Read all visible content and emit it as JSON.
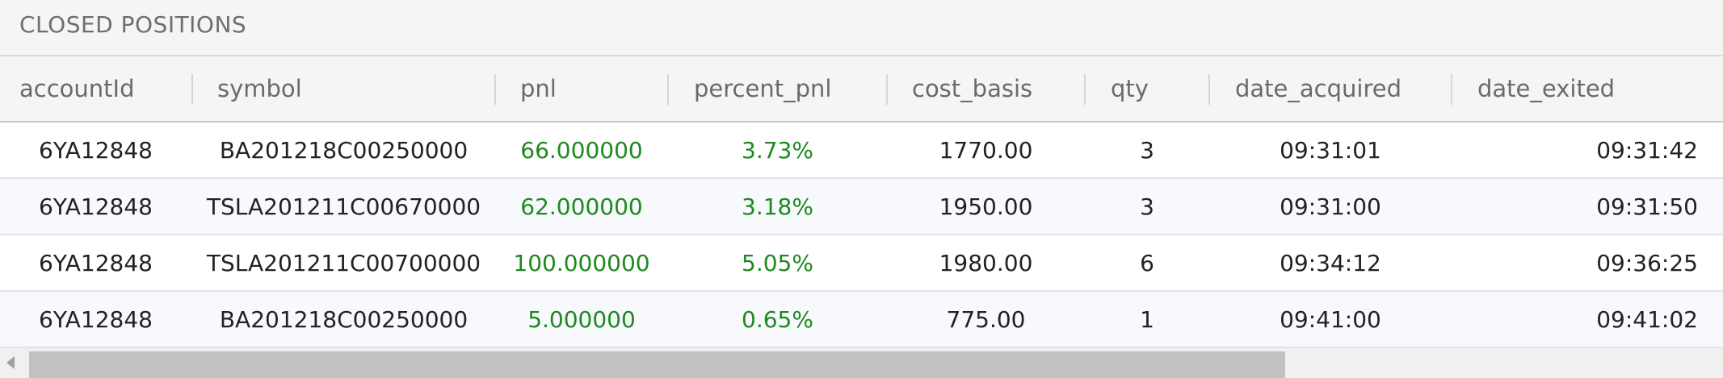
{
  "panel": {
    "title": "CLOSED POSITIONS"
  },
  "columns": {
    "accountId": "accountId",
    "symbol": "symbol",
    "pnl": "pnl",
    "percent_pnl": "percent_pnl",
    "cost_basis": "cost_basis",
    "qty": "qty",
    "date_acquired": "date_acquired",
    "date_exited": "date_exited"
  },
  "rows": [
    {
      "accountId": "6YA12848",
      "symbol": "BA201218C00250000",
      "pnl": "66.000000",
      "percent_pnl": "3.73%",
      "cost_basis": "1770.00",
      "qty": "3",
      "date_acquired": "09:31:01",
      "date_exited": "09:31:42"
    },
    {
      "accountId": "6YA12848",
      "symbol": "TSLA201211C00670000",
      "pnl": "62.000000",
      "percent_pnl": "3.18%",
      "cost_basis": "1950.00",
      "qty": "3",
      "date_acquired": "09:31:00",
      "date_exited": "09:31:50"
    },
    {
      "accountId": "6YA12848",
      "symbol": "TSLA201211C00700000",
      "pnl": "100.000000",
      "percent_pnl": "5.05%",
      "cost_basis": "1980.00",
      "qty": "6",
      "date_acquired": "09:34:12",
      "date_exited": "09:36:25"
    },
    {
      "accountId": "6YA12848",
      "symbol": "BA201218C00250000",
      "pnl": "5.000000",
      "percent_pnl": "0.65%",
      "cost_basis": "775.00",
      "qty": "1",
      "date_acquired": "09:41:00",
      "date_exited": "09:41:02"
    }
  ],
  "colors": {
    "positive": "#1e8a1e",
    "header_bg": "#f5f5f5",
    "row_alt_bg": "#f7f9fc"
  },
  "icons": {
    "scroll_left": "scroll-left-arrow-icon"
  }
}
